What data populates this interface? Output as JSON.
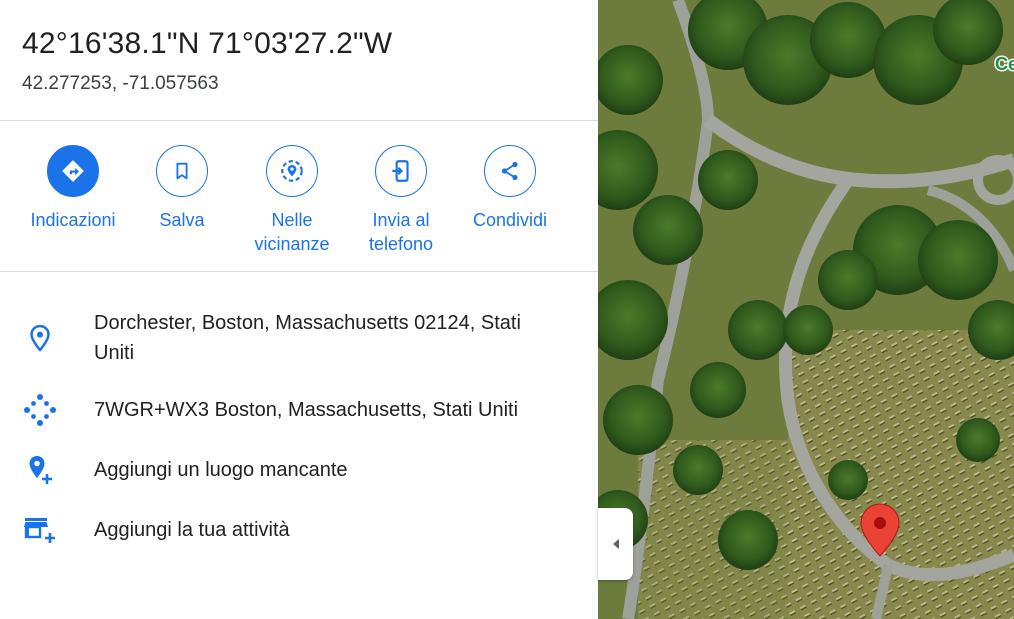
{
  "place": {
    "dms": "42°16'38.1\"N 71°03'27.2\"W",
    "decimal": "42.277253, -71.057563"
  },
  "actions": [
    {
      "label": "Indicazioni",
      "icon": "directions-icon"
    },
    {
      "label": "Salva",
      "icon": "bookmark-icon"
    },
    {
      "label": "Nelle vicinanze",
      "icon": "nearby-icon"
    },
    {
      "label": "Invia al telefono",
      "icon": "send-to-phone-icon"
    },
    {
      "label": "Condividi",
      "icon": "share-icon"
    }
  ],
  "details": {
    "address": "Dorchester, Boston, Massachusetts 02124, Stati Uniti",
    "plus_code": "7WGR+WX3 Boston, Massachusetts, Stati Uniti",
    "add_missing_place": "Aggiungi un luogo mancante",
    "add_business": "Aggiungi la tua attività"
  },
  "map": {
    "edge_label": "Ce"
  },
  "colors": {
    "accent": "#1a73e8",
    "pin": "#ea4335",
    "text": "#202124"
  }
}
